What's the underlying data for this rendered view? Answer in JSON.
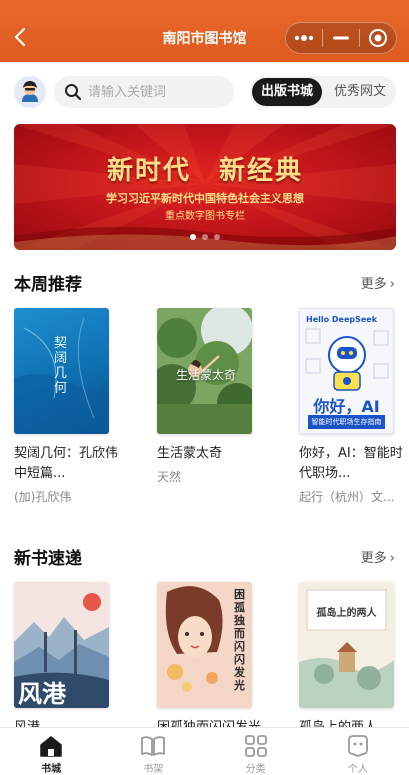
{
  "header": {
    "title": "南阳市图书馆",
    "back_icon": "chevron-left-icon",
    "more_icon": "more-dots-icon",
    "minimize_icon": "minus-icon",
    "close_icon": "target-circle-icon",
    "brand_color": "#e0622a"
  },
  "search": {
    "avatar_icon": "user-avatar-icon",
    "placeholder": "请输入关键词",
    "value": "",
    "icon": "search-icon",
    "tabs": [
      {
        "label": "出版书城",
        "active": true
      },
      {
        "label": "优秀网文",
        "active": false
      }
    ]
  },
  "banner": {
    "headline": "新时代　新经典",
    "subtitle_line1": "学习习近平新时代中国特色社会主义思想",
    "subtitle_line2": "重点数字图书专栏",
    "dots": 3,
    "active_dot": 0
  },
  "weekly": {
    "title": "本周推荐",
    "more_label": "更多",
    "books": [
      {
        "title": "契阔几何：孔欣伟中短篇...",
        "author": "(加)孔欣伟",
        "cover_text": "契阔几何"
      },
      {
        "title": "生活蒙太奇",
        "author": "天然",
        "cover_text": "生活蒙太奇"
      },
      {
        "title": "你好，AI：智能时代职场...",
        "author": "起行（杭州）文...",
        "cover_text_top": "Hello DeepSeek",
        "cover_text_main": "你好，AI",
        "cover_text_sub": "智能时代职场生存指南"
      }
    ]
  },
  "newbooks": {
    "title": "新书速递",
    "more_label": "更多",
    "books": [
      {
        "title": "风港",
        "cover_text": "风港"
      },
      {
        "title": "困孤独而闪闪发光",
        "cover_text": "困孤独而闪闪发光"
      },
      {
        "title": "孤岛上的两人",
        "cover_text": "孤岛上的两人"
      }
    ]
  },
  "tabbar": {
    "items": [
      {
        "label": "书城",
        "icon": "home-icon",
        "active": true
      },
      {
        "label": "书架",
        "icon": "bookshelf-icon",
        "active": false
      },
      {
        "label": "分类",
        "icon": "category-grid-icon",
        "active": false
      },
      {
        "label": "个人",
        "icon": "profile-icon",
        "active": false
      }
    ]
  }
}
